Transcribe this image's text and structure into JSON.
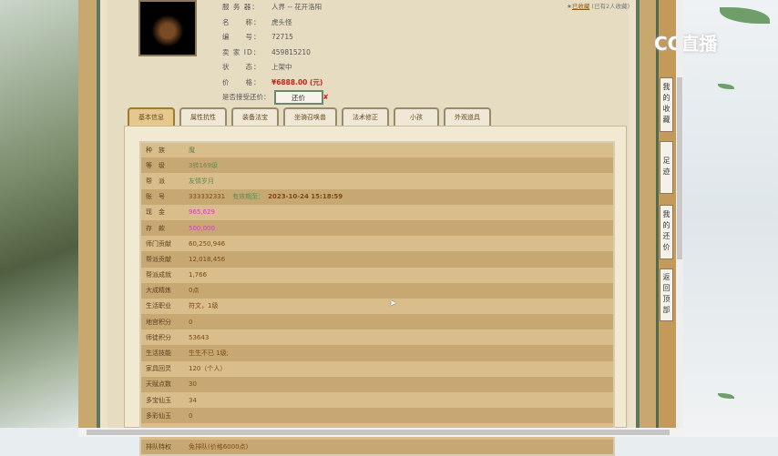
{
  "info": {
    "rows": [
      {
        "label": "服 务 器：",
        "value": "人界 -- 花开洛阳"
      },
      {
        "label": "名　　称：",
        "value": "虎头怪"
      },
      {
        "label": "编　　号：",
        "value": "72715"
      },
      {
        "label": "卖 家 ID：",
        "value": "459815210"
      },
      {
        "label": "状　　态：",
        "value": "上架中"
      },
      {
        "label": "价　　格：",
        "value": "¥6888.00 (元)"
      }
    ],
    "bargain_label": "是否接受还价：",
    "bargain_button": "还价",
    "bargain_mark": "✘"
  },
  "favorite": {
    "label": "已收藏",
    "count": "(已有2人收藏)"
  },
  "tabs": [
    "基本信息",
    "属性抗性",
    "装备法宝",
    "坐骑召唤兽",
    "法术修正",
    "小孩",
    "外观道具"
  ],
  "table": [
    {
      "k": "种　族",
      "v": "魔",
      "c": "green"
    },
    {
      "k": "等　级",
      "v": "3转169级",
      "c": "green"
    },
    {
      "k": "帮　派",
      "v": "友情岁月",
      "c": "green"
    },
    {
      "k": "账　号",
      "v": "333332331",
      "c": "brown",
      "extra_label": "有效期至：",
      "extra": "2023-10-24 15:18:59"
    },
    {
      "k": "现　金",
      "v": "965,629",
      "c": "pink"
    },
    {
      "k": "存　款",
      "v": "500,000",
      "c": "pink"
    },
    {
      "k": "师门贡献",
      "v": "60,250,946",
      "c": "brown"
    },
    {
      "k": "帮派贡献",
      "v": "12,018,456",
      "c": "brown"
    },
    {
      "k": "帮派成就",
      "v": "1,766",
      "c": "brown"
    },
    {
      "k": "大成精炼",
      "v": "0点",
      "c": "brown"
    },
    {
      "k": "生活职业",
      "v": "符文，1级",
      "c": "brown"
    },
    {
      "k": "地宫积分",
      "v": "0",
      "c": "brown"
    },
    {
      "k": "师徒积分",
      "v": "53643",
      "c": "brown"
    },
    {
      "k": "生活技能",
      "v": "生生不已 1级;",
      "c": "brown"
    },
    {
      "k": "家具回灵",
      "v": "120（个人）",
      "c": "brown"
    },
    {
      "k": "天赋点数",
      "v": "30",
      "c": "brown"
    },
    {
      "k": "多宝仙玉",
      "v": "34",
      "c": "brown"
    },
    {
      "k": "多彩仙玉",
      "v": "0",
      "c": "brown"
    },
    {
      "k": "功德点数",
      "v": "3253",
      "c": "brown"
    },
    {
      "k": "排队特权",
      "v": "免排队(价格6000点)",
      "c": "brown"
    }
  ],
  "side_nav": [
    "我的收藏",
    "足迹",
    "我的还价",
    "返回顶部"
  ],
  "logo": "CC直播",
  "colors": {
    "accent_price": "#c8201a",
    "pink_value": "#d43cc8",
    "green_value": "#5e8a52",
    "frame_green": "#5b7760"
  }
}
